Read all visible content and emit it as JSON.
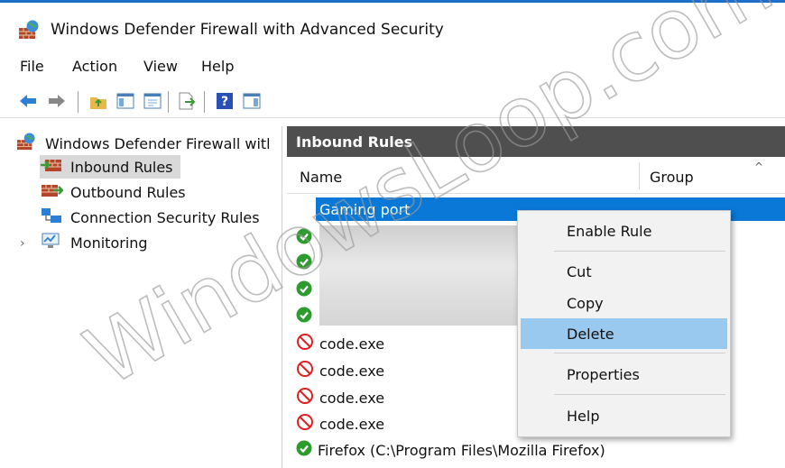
{
  "window": {
    "title": "Windows Defender Firewall with Advanced Security"
  },
  "menu": [
    "File",
    "Action",
    "View",
    "Help"
  ],
  "toolbar": [
    "back-arrow-icon",
    "forward-arrow-icon",
    "up-folder-icon",
    "show-hide-tree-icon",
    "console-icon",
    "export-icon",
    "help-icon",
    "action-pane-icon"
  ],
  "tree": {
    "root": "Windows Defender Firewall witl",
    "items": [
      "Inbound Rules",
      "Outbound Rules",
      "Connection Security Rules",
      "Monitoring"
    ]
  },
  "pane": {
    "header": "Inbound Rules",
    "columns": {
      "name": "Name",
      "group": "Group"
    },
    "selected_row": "Gaming port",
    "rows": [
      {
        "status": "allowed",
        "name": ""
      },
      {
        "status": "allowed",
        "name": ""
      },
      {
        "status": "allowed",
        "name": ""
      },
      {
        "status": "allowed",
        "name": ""
      },
      {
        "status": "blocked",
        "name": "code.exe"
      },
      {
        "status": "blocked",
        "name": "code.exe"
      },
      {
        "status": "blocked",
        "name": "code.exe"
      },
      {
        "status": "blocked",
        "name": "code.exe"
      },
      {
        "status": "allowed",
        "name": "Firefox (C:\\Program Files\\Mozilla Firefox)"
      }
    ]
  },
  "context_menu": {
    "items": [
      "Enable Rule",
      "Cut",
      "Copy",
      "Delete",
      "Properties",
      "Help"
    ],
    "highlighted": "Delete"
  },
  "watermark": "WindowsLoop.com",
  "colors": {
    "selection": "#0a78d7",
    "menu_highlight": "#99c9ef",
    "pane_header": "#4f4f4f",
    "allow": "#2e9b2e",
    "block": "#e02020"
  }
}
